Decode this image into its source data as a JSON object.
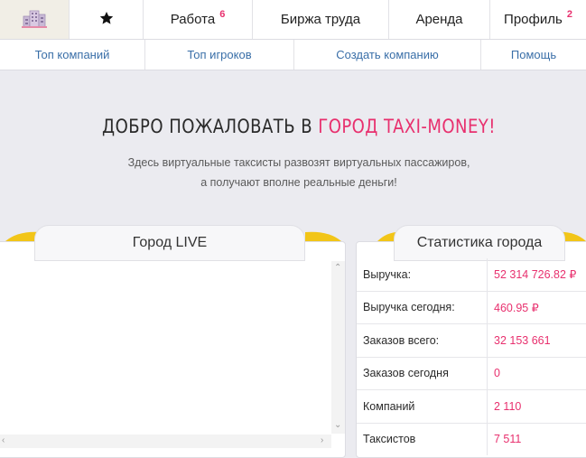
{
  "topnav": {
    "home_icon": "city-building-icon",
    "favorites_icon": "star-icon",
    "items": [
      {
        "label": "Работа",
        "badge": "6"
      },
      {
        "label": "Биржа труда",
        "badge": ""
      },
      {
        "label": "Аренда",
        "badge": ""
      },
      {
        "label": "Профиль",
        "badge": "2"
      }
    ]
  },
  "subnav": {
    "items": [
      {
        "label": "Топ компаний"
      },
      {
        "label": "Топ игроков"
      },
      {
        "label": "Создать компанию"
      },
      {
        "label": "Помощь"
      }
    ]
  },
  "hero": {
    "title_prefix": "ДОБРО ПОЖАЛОВАТЬ В",
    "title_accent": "ГОРОД TAXI-MONEY!",
    "subtitle_line1": "Здесь виртуальные таксисты развозят виртуальных пассажиров,",
    "subtitle_line2": "а получают вполне реальные деньги!"
  },
  "live_panel": {
    "title": "Город LIVE"
  },
  "stats_panel": {
    "title": "Статистика города",
    "rows": [
      {
        "label": "Выручка:",
        "value": "52 314 726.82 ₽"
      },
      {
        "label": "Выручка сегодня:",
        "value": "460.95 ₽"
      },
      {
        "label": "Заказов всего:",
        "value": "32 153 661"
      },
      {
        "label": "Заказов сегодня",
        "value": "0"
      },
      {
        "label": "Компаний",
        "value": "2 110"
      },
      {
        "label": "Таксистов",
        "value": "7 511"
      }
    ]
  },
  "colors": {
    "accent": "#e8306e",
    "link": "#3a6fa8",
    "background": "#ebebf0",
    "gold": "#f2c518"
  }
}
